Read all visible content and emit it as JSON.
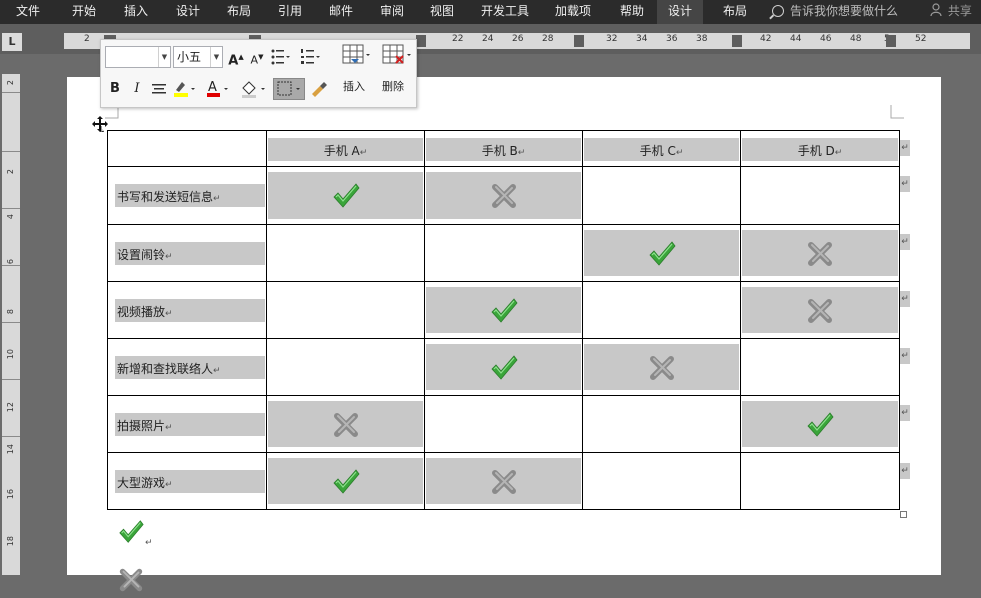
{
  "ribbon": {
    "tabs": [
      "文件",
      "开始",
      "插入",
      "设计",
      "布局",
      "引用",
      "邮件",
      "审阅",
      "视图",
      "开发工具",
      "加载项",
      "帮助",
      "设计",
      "布局"
    ],
    "active_index": 12,
    "search_placeholder": "告诉我你想要做什么",
    "share_label": "共享"
  },
  "ruler": {
    "corner_label": "L",
    "h_numbers": [
      "2",
      "22",
      "24",
      "26",
      "28",
      "32",
      "34",
      "36",
      "38",
      "42",
      "44",
      "46",
      "48",
      "5",
      "52"
    ],
    "v_numbers": [
      "2",
      "2",
      "4",
      "6",
      "8",
      "10",
      "12",
      "14",
      "16",
      "18"
    ]
  },
  "mini_toolbar": {
    "font_name": "",
    "font_size": "小五",
    "bold": "B",
    "italic": "I",
    "insert_label": "插入",
    "delete_label": "删除",
    "highlight_color": "#ffff00",
    "font_color": "#e00000"
  },
  "table": {
    "headers": [
      "",
      "手机 A",
      "手机 B",
      "手机 C",
      "手机 D"
    ],
    "rows": [
      {
        "label": "书写和发送短信息",
        "cells": [
          "check",
          "cross",
          "",
          ""
        ]
      },
      {
        "label": "设置闹铃",
        "cells": [
          "",
          "",
          "check",
          "cross"
        ]
      },
      {
        "label": "视频播放",
        "cells": [
          "",
          "check",
          "",
          "cross"
        ]
      },
      {
        "label": "新增和查找联络人",
        "cells": [
          "",
          "check",
          "cross",
          ""
        ]
      },
      {
        "label": "拍摄照片",
        "cells": [
          "cross",
          "",
          "",
          "check"
        ]
      },
      {
        "label": "大型游戏",
        "cells": [
          "check",
          "cross",
          "",
          ""
        ]
      }
    ]
  },
  "legend": [
    "check",
    "cross"
  ],
  "colors": {
    "check": "#3aa53a",
    "cross": "#8a8a8a",
    "shade": "#c8c8c8"
  }
}
